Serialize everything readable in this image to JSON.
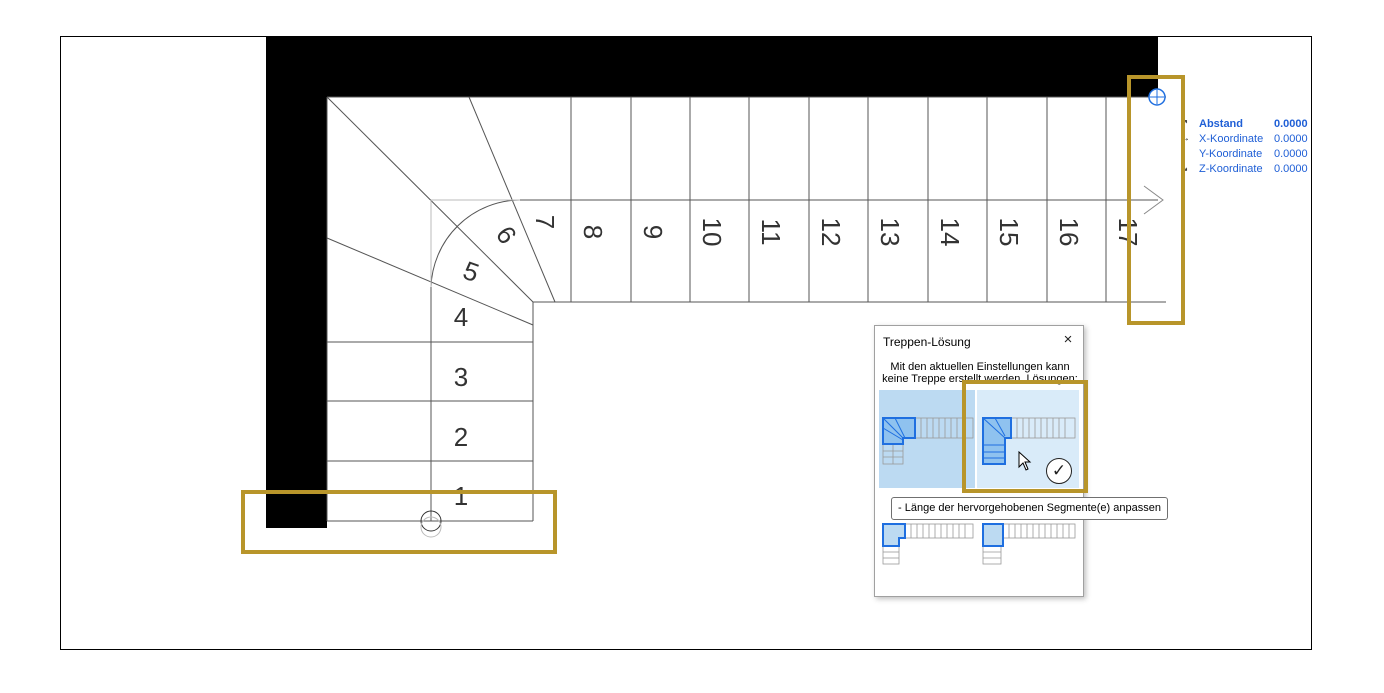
{
  "stair": {
    "steps": [
      "1",
      "2",
      "3",
      "4",
      "5",
      "6",
      "7",
      "8",
      "9",
      "10",
      "11",
      "12",
      "13",
      "14",
      "15",
      "16",
      "17"
    ]
  },
  "coordinates": [
    {
      "icon": "↗",
      "label": "Abstand",
      "value": "0.0000"
    },
    {
      "icon": "→",
      "label": "X-Koordinate",
      "value": "0.0000"
    },
    {
      "icon": "↕",
      "label": "Y-Koordinate",
      "value": "0.0000"
    },
    {
      "icon": "↘",
      "label": "Z-Koordinate",
      "value": "0.0000"
    }
  ],
  "dialog": {
    "title": "Treppen-Lösung",
    "close": "×",
    "message": "Mit den aktuellen Einstellungen kann keine Treppe erstellt werden. Lösungen:",
    "check": "✓"
  },
  "tooltip": "- Länge der hervorgehobenen Segmente(e) anpassen",
  "colors": {
    "highlight": "#b8952a",
    "selection": "#bcdaf2",
    "hover": "#d9ebf9",
    "segment": "#1f6fe0",
    "coordinate_text": "#1f5fd6"
  }
}
